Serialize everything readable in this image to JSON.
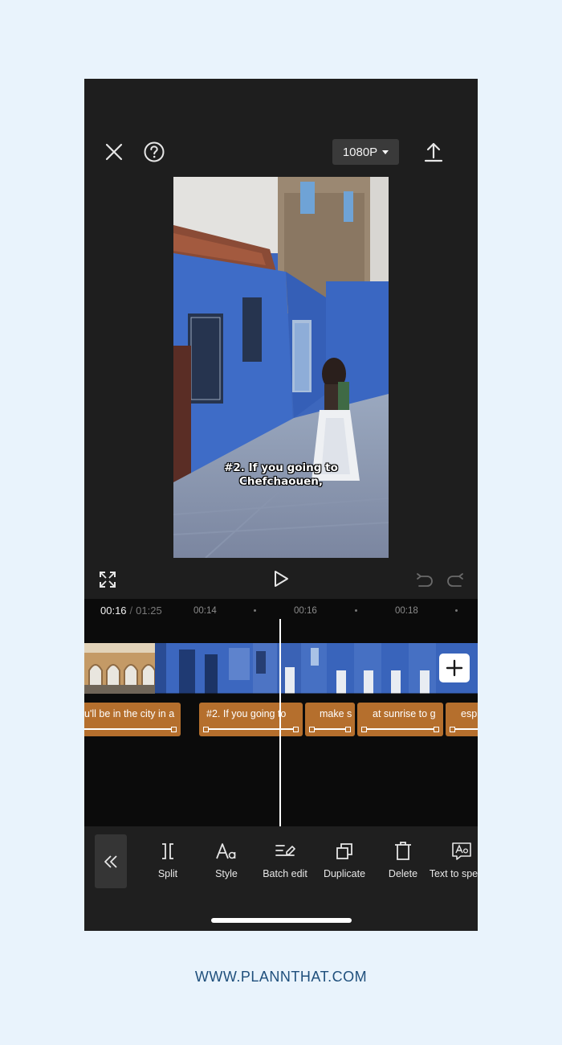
{
  "header": {
    "resolution_label": "1080P",
    "close_icon": "close-icon",
    "help_icon": "help-icon",
    "export_icon": "export-icon"
  },
  "preview": {
    "caption": "#2. If you going to\nChefchaouen,"
  },
  "timeline": {
    "current_time": "00:16",
    "separator": "/",
    "total_time": "01:25",
    "ticks": [
      "00:14",
      "00:16",
      "00:18"
    ]
  },
  "text_clips": [
    {
      "label": "u'll be in the city in a"
    },
    {
      "label": "#2. If you going to"
    },
    {
      "label": "make s"
    },
    {
      "label": "at sunrise to g"
    },
    {
      "label": "esp"
    }
  ],
  "toolbar": {
    "items": [
      {
        "label": "Split",
        "icon": "split-icon"
      },
      {
        "label": "Style",
        "icon": "text-style-icon"
      },
      {
        "label": "Batch edit",
        "icon": "batch-edit-icon"
      },
      {
        "label": "Duplicate",
        "icon": "duplicate-icon"
      },
      {
        "label": "Delete",
        "icon": "delete-icon"
      },
      {
        "label": "Text to speech",
        "icon": "text-to-speech-icon"
      }
    ]
  },
  "footer": {
    "website": "WWW.PLANNTHAT.COM"
  },
  "colors": {
    "page_bg": "#e9f3fc",
    "app_bg": "#1e1e1e",
    "text_clip": "#b56f2d",
    "footer_text": "#1f4f7c"
  }
}
